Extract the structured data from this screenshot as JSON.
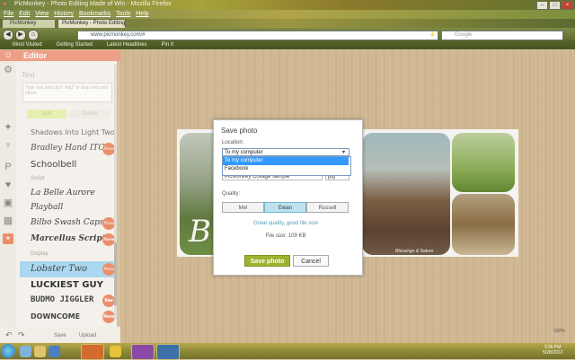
{
  "browser": {
    "window_title": "PicMonkey - Photo Editing Made of Win - Mozilla Firefox",
    "menu": [
      "File",
      "Edit",
      "View",
      "History",
      "Bookmarks",
      "Tools",
      "Help"
    ],
    "tab_label": "PicMonkey - Photo Editing Made of Win!",
    "tab_inactive": "PicMonkey",
    "url": "www.picmonkey.com/#",
    "search_placeholder": "Google",
    "bookmarks": [
      "Most Visited",
      "Getting Started",
      "Latest Headlines",
      "Pin It"
    ]
  },
  "editor": {
    "header": "Editor",
    "panel_title": "Text",
    "text_placeholder": "Type text and click \"Add\" to drop text onto photo",
    "add_label": "Add",
    "delete_label": "Delete",
    "fonts_top": [
      {
        "name": "Shadows Into Light Two",
        "new": false
      },
      {
        "name": "Bradley Hand ITC",
        "new": true
      },
      {
        "name": "Schoolbell",
        "new": false
      }
    ],
    "cat_script": "Script",
    "fonts_script": [
      {
        "name": "La Belle Aurore",
        "new": false
      },
      {
        "name": "Playball",
        "new": false
      },
      {
        "name": "Bilbo Swash Caps",
        "new": true
      },
      {
        "name": "Marcellus Script",
        "new": true
      }
    ],
    "cat_display": "Display",
    "fonts_display": [
      {
        "name": "Lobster Two",
        "new": true,
        "selected": true
      },
      {
        "name": "LUCKIEST GUY",
        "new": false
      },
      {
        "name": "BUDMO JIGGLER",
        "new": true
      },
      {
        "name": "DOWNCOME",
        "new": true
      }
    ],
    "new_badge": "New",
    "bottom_undo": "↶",
    "bottom_redo": "↷",
    "bottom_save": "Save",
    "bottom_upload": "Upload"
  },
  "canvas": {
    "watermark": "Blessings & Nature",
    "letter": "B",
    "zoom": "100%"
  },
  "dialog": {
    "title": "Save photo",
    "location_label": "Location:",
    "location_value": "To my computer",
    "location_options": [
      "To my computer",
      "Facebook"
    ],
    "filename": "PicMonkey Collage sample",
    "format": "jpg",
    "quality_label": "Quality:",
    "quality_options": [
      "Mel",
      "Ewan",
      "Russell"
    ],
    "quality_selected": "Ewan",
    "quality_desc": "Great quality, good file size",
    "filesize": "File size: 109 KB",
    "save_label": "Save photo",
    "cancel_label": "Cancel"
  },
  "taskbar": {
    "time": "3:36 PM",
    "date": "5/28/2012"
  },
  "colors": {
    "accent": "#ee9e86",
    "save_green": "#9cb22f",
    "selected_quality": "#bfe3ee",
    "dropdown_highlight": "#3399ff"
  }
}
